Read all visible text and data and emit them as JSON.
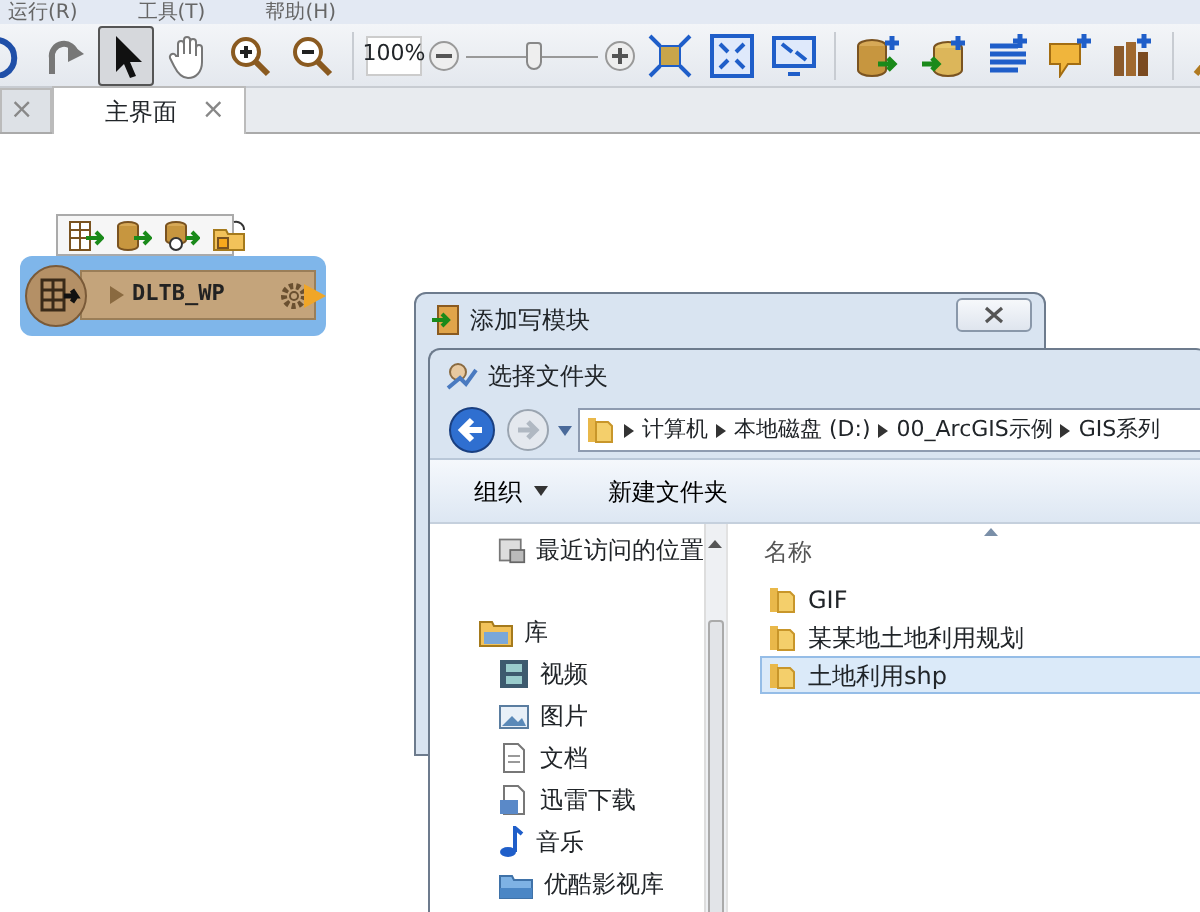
{
  "menu": [
    {
      "label": "运行(R)"
    },
    {
      "label": "工具(T)"
    },
    {
      "label": "帮助(H)"
    }
  ],
  "toolbar": {
    "tools": [
      {
        "kind": "undo",
        "selected": false
      },
      {
        "kind": "redo",
        "selected": false
      },
      {
        "kind": "pointer",
        "selected": true
      },
      {
        "kind": "hand",
        "selected": false
      },
      {
        "kind": "zoom-in",
        "selected": false
      },
      {
        "kind": "zoom-out",
        "selected": false
      }
    ],
    "zoom": {
      "value": "100%",
      "level": 0.52
    },
    "view_tools": [
      {
        "kind": "fit"
      },
      {
        "kind": "expand"
      },
      {
        "kind": "screen"
      }
    ],
    "add_tools": [
      {
        "kind": "reader"
      },
      {
        "kind": "writer"
      },
      {
        "kind": "list"
      },
      {
        "kind": "note"
      },
      {
        "kind": "books"
      }
    ],
    "extra_tools": [
      {
        "kind": "inspect"
      }
    ]
  },
  "tabs": [
    {
      "close": "×",
      "selected": false
    },
    {
      "label": "主界面",
      "close": "×",
      "selected": true
    }
  ],
  "canvas": {
    "node_toolbar": [
      {
        "kind": "table-out"
      },
      {
        "kind": "db-out"
      },
      {
        "kind": "db-gear"
      },
      {
        "kind": "folder-lock"
      }
    ],
    "node": {
      "name": "DLTB_WP",
      "selected": true
    }
  },
  "dialogs": [
    {
      "title": "添加写模块"
    },
    {
      "title": "选择文件夹",
      "breadcrumbs": [
        "计算机",
        "本地磁盘 (D:)",
        "00_ArcGIS示例",
        "GIS系列"
      ],
      "commands": [
        {
          "label": "组织",
          "dropdown": true
        },
        {
          "label": "新建文件夹",
          "dropdown": false
        }
      ],
      "nav": [
        {
          "label": "最近访问的位置",
          "kind": "recent"
        },
        {
          "label": "库",
          "kind": "library",
          "children": [
            {
              "label": "视频",
              "kind": "video"
            },
            {
              "label": "图片",
              "kind": "picture"
            },
            {
              "label": "文档",
              "kind": "document"
            },
            {
              "label": "迅雷下载",
              "kind": "download"
            },
            {
              "label": "音乐",
              "kind": "music"
            },
            {
              "label": "优酷影视库",
              "kind": "media"
            }
          ]
        }
      ],
      "column": "名称",
      "files": [
        {
          "name": "GIF",
          "selected": false
        },
        {
          "name": "某某地土地利用规划",
          "selected": false
        },
        {
          "name": "土地利用shp",
          "selected": true
        }
      ]
    }
  ]
}
